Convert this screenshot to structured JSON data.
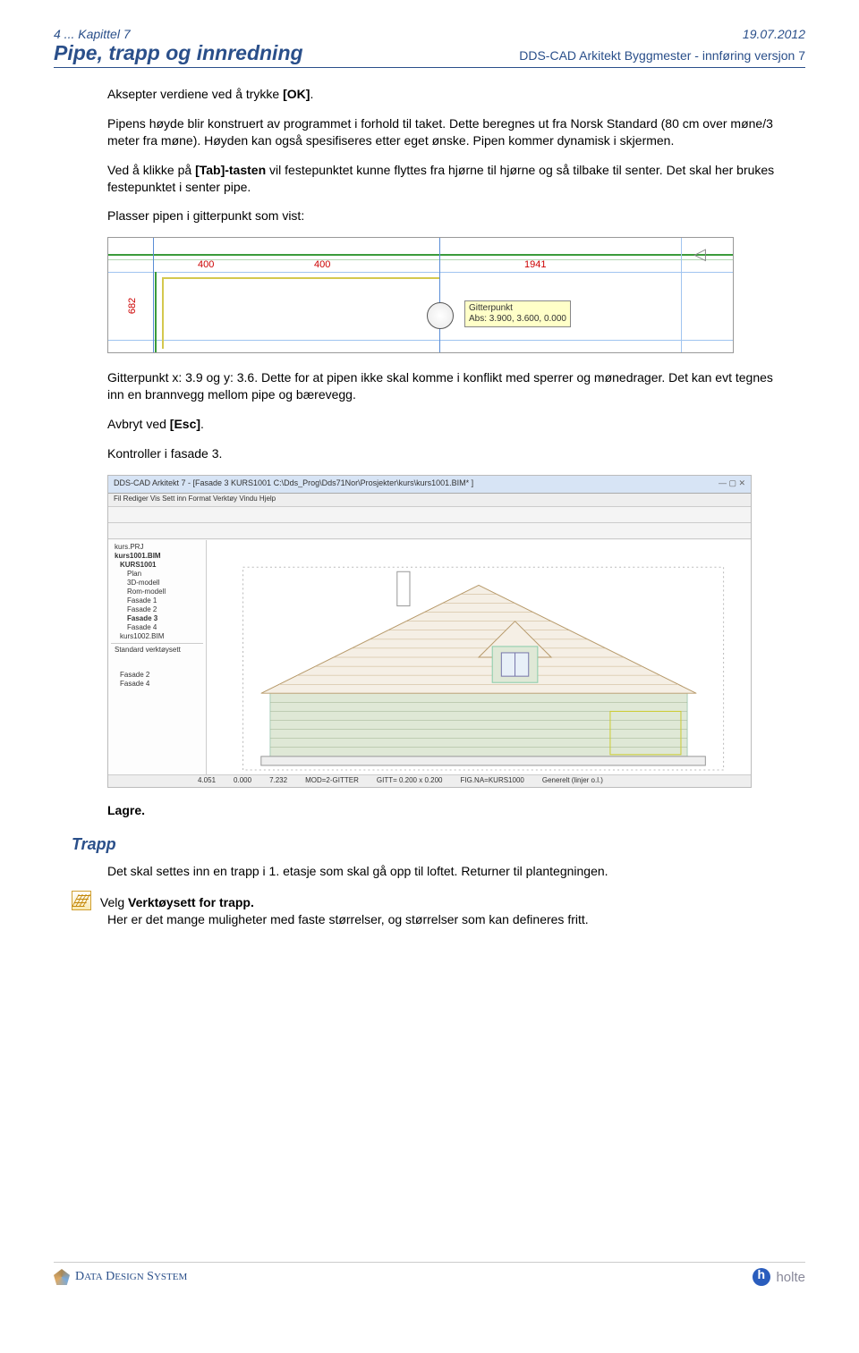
{
  "header": {
    "page_ref": "4 ... Kapittel 7",
    "date": "19.07.2012",
    "main_title": "Pipe, trapp og innredning",
    "product": "DDS-CAD Arkitekt Byggmester - innføring versjon 7"
  },
  "content": {
    "p1": "Aksepter verdiene ved å trykke [OK].",
    "p2": "Pipens høyde blir konstruert av programmet i forhold til taket. Dette beregnes ut fra Norsk Standard (80 cm over møne/3 meter fra møne). Høyden kan også spesifiseres etter eget ønske. Pipen kommer dynamisk i skjermen.",
    "p3": "Ved å klikke på [Tab]-tasten vil festepunktet kunne flyttes fra hjørne til hjørne og så tilbake til senter. Det skal her brukes festepunktet i senter pipe.",
    "p4": "Plasser pipen i gitterpunkt som vist:",
    "p5": "Gitterpunkt x: 3.9 og y: 3.6. Dette for at pipen ikke skal komme i konflikt med sperrer og mønedrager. Det kan evt tegnes inn en brannvegg mellom pipe og bærevegg.",
    "p6": "Avbryt ved [Esc].",
    "p7": "Kontroller i fasade 3.",
    "p8": "Lagre.",
    "p9": "Det skal settes inn en trapp i 1. etasje som skal gå opp til loftet. Returner til plantegningen.",
    "p10a": "Velg Verktøysett for trapp.",
    "p10b": "Her er det mange muligheter med faste størrelser, og størrelser som kan defineres fritt.",
    "section_heading": "Trapp"
  },
  "figure1": {
    "dim_a": "400",
    "dim_b": "400",
    "dim_c": "1941",
    "dim_side": "682",
    "tooltip_line1": "Gitterpunkt",
    "tooltip_line2": "Abs: 3.900, 3.600, 0.000"
  },
  "figure2": {
    "title": "DDS-CAD Arkitekt 7 - [Fasade 3  KURS1001  C:\\Dds_Prog\\Dds71Nor\\Prosjekter\\kurs\\kurs1001.BIM* ]",
    "menu": "Fil  Rediger  Vis  Sett inn  Format  Verktøy  Vindu  Hjelp",
    "tree": {
      "prj": "kurs.PRJ",
      "bim": "kurs1001.BIM",
      "model": "KURS1001",
      "items": [
        "Plan",
        "3D-modell",
        "Rom-modell",
        "Fasade 1",
        "Fasade 2",
        "Fasade 3",
        "Fasade 4"
      ],
      "bim2": "kurs1002.BIM",
      "std": "Standard verktøysett",
      "items2": [
        "Fasade 2",
        "Fasade 4"
      ]
    },
    "status": {
      "s1": "4.051",
      "s2": "0.000",
      "s3": "7.232",
      "s4": "MOD=2-GITTER",
      "s5": "GITT= 0.200 x 0.200",
      "s6": "FIG.NA=KURS1000",
      "s7": "Generelt (linjer o.l.)"
    }
  },
  "footer": {
    "company": "DATA DESIGN SYSTEM",
    "partner": "holte"
  }
}
